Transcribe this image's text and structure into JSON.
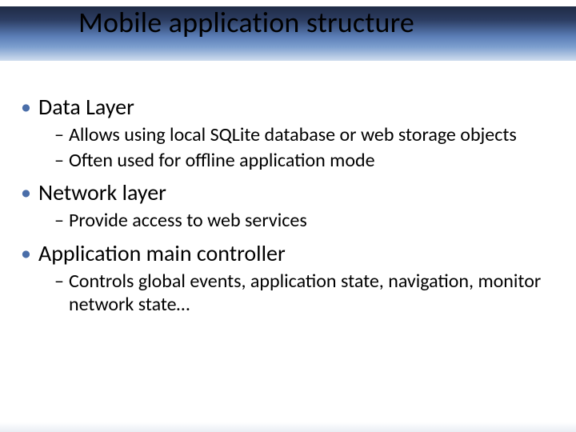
{
  "title": "Mobile application structure",
  "bullets": [
    {
      "label": "Data Layer",
      "sub": [
        "Allows using local SQLite database or web storage objects",
        "Often used for offline application mode"
      ]
    },
    {
      "label": "Network layer",
      "sub": [
        "Provide access to web services"
      ]
    },
    {
      "label": "Application main controller",
      "sub": [
        "Controls global events, application state, navigation, monitor network state…"
      ]
    }
  ]
}
